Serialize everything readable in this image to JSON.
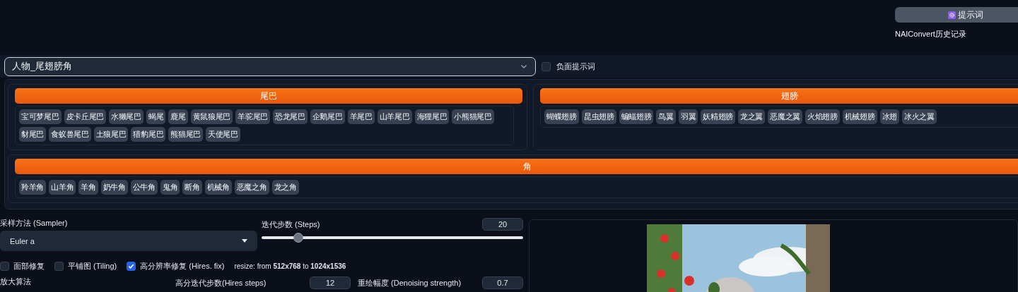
{
  "top": {
    "prompt_button": "提示词",
    "history_label": "NAIConvert历史记录"
  },
  "preset": {
    "value": "人物_尾翅膀角"
  },
  "negative": {
    "label": "负面提示词",
    "checked": false
  },
  "tag_groups": [
    {
      "title": "尾巴",
      "tags": [
        "宝可梦尾巴",
        "皮卡丘尾巴",
        "水獭尾巴",
        "蝎尾",
        "鹿尾",
        "黄鼠狼尾巴",
        "羊驼尾巴",
        "恐龙尾巴",
        "企鹅尾巴",
        "羊尾巴",
        "山羊尾巴",
        "海狸尾巴",
        "小熊猫尾巴",
        "豺尾巴",
        "食蚁兽尾巴",
        "土狼尾巴",
        "猎豹尾巴",
        "熊猫尾巴",
        "天使尾巴"
      ]
    },
    {
      "title": "翅膀",
      "tags": [
        "蝴蝶翅膀",
        "昆虫翅膀",
        "蝙蝠翅膀",
        "鸟翼",
        "羽翼",
        "妖精翅膀",
        "龙之翼",
        "恶魔之翼",
        "火焰翅膀",
        "机械翅膀",
        "冰翅",
        "冰火之翼"
      ]
    },
    {
      "title": "角",
      "tags": [
        "羚羊角",
        "山羊角",
        "羊角",
        "奶牛角",
        "公牛角",
        "鬼角",
        "断角",
        "机械角",
        "恶魔之角",
        "龙之角"
      ]
    }
  ],
  "settings": {
    "sampler": {
      "label": "采样方法 (Sampler)",
      "value": "Euler a"
    },
    "steps": {
      "label": "迭代步数 (Steps)",
      "value": "20",
      "level": 0.14
    },
    "options": [
      {
        "label": "面部修复",
        "checked": false
      },
      {
        "label": "平铺图 (Tiling)",
        "checked": false
      },
      {
        "label": "高分辨率修复 (Hires. fix)",
        "checked": true
      }
    ],
    "resize_note": "resize: from **512x768** to **1024x1536**",
    "upscaler": {
      "label": "放大算法"
    },
    "hires_steps": {
      "label": "高分迭代步数(Hires steps)",
      "value": "12"
    },
    "denoising": {
      "label": "重绘幅度 (Denoising strength)",
      "value": "0.7"
    }
  }
}
